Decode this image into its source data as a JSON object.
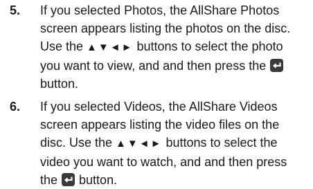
{
  "steps": [
    {
      "number": "5.",
      "lines": [
        "If you selected Photos, the AllShare Photos",
        "screen appears listing the photos on the disc.",
        [
          "Use the ",
          "▲▼◄►",
          " buttons to select the photo"
        ],
        [
          "you want to view, and and then press the ",
          "enter-icon"
        ],
        "button."
      ]
    },
    {
      "number": "6.",
      "lines": [
        "If you selected Videos, the AllShare Videos",
        "screen appears listing the video files on the",
        [
          "disc. Use the ",
          "▲▼◄►",
          " buttons to select the"
        ],
        "video you want to watch, and and then press",
        [
          "the ",
          "enter-icon",
          " button."
        ]
      ]
    }
  ],
  "step5": {
    "number": "5.",
    "line1": "If you selected Photos, the AllShare Photos",
    "line2": "screen appears listing the photos on the disc.",
    "line3_a": "Use the ",
    "line3_arrows": "▲▼◄►",
    "line3_b": " buttons to select the photo",
    "line4": "you want to view, and and then press the ",
    "line5": "button."
  },
  "step6": {
    "number": "6.",
    "line1": "If you selected Videos, the AllShare Videos",
    "line2": "screen appears listing the video files on the",
    "line3_a": "disc. Use the ",
    "line3_arrows": "▲▼◄►",
    "line3_b": " buttons to select the",
    "line4": "video you want to watch, and and then press",
    "line5_a": "the ",
    "line5_b": " button."
  },
  "icons": {
    "enter": "enter-icon",
    "enter_color": "#3a3a3a"
  }
}
